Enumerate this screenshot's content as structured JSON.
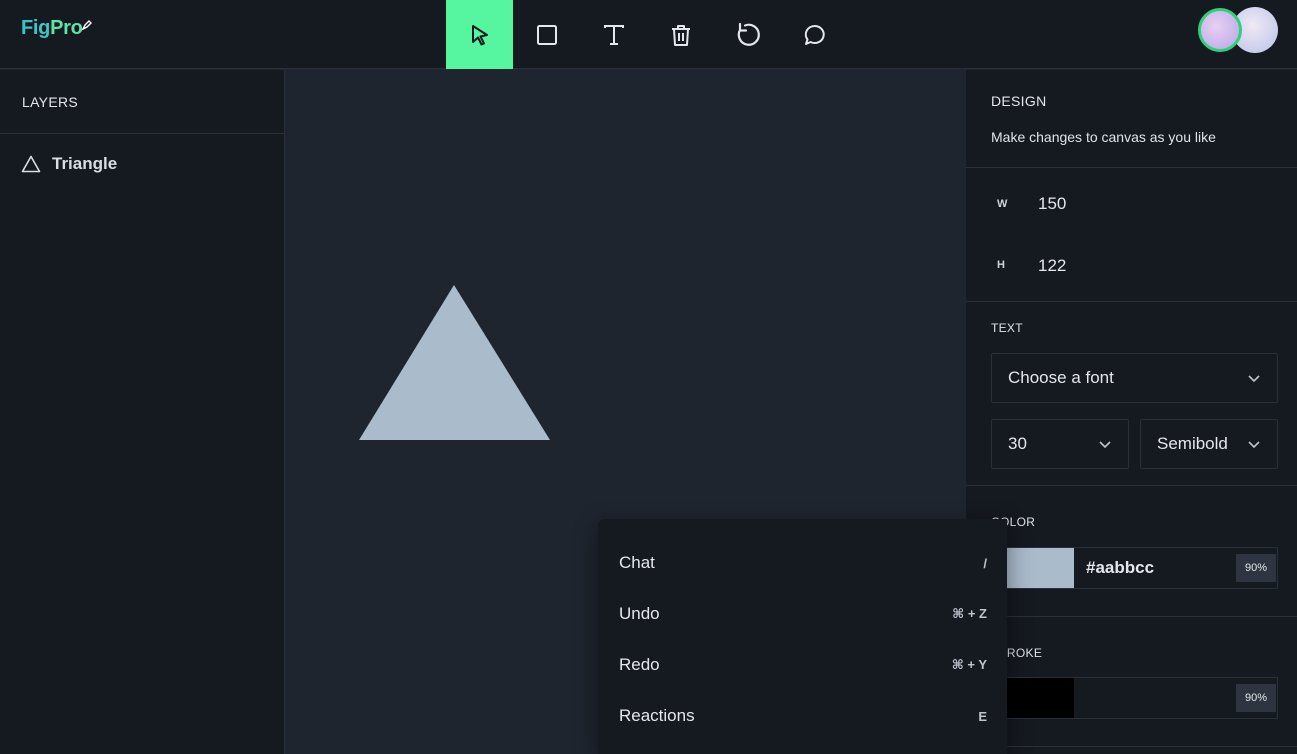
{
  "app": {
    "logo_text": "FigPro"
  },
  "toolbar": {
    "tools": [
      {
        "name": "select",
        "icon": "cursor-icon",
        "active": true
      },
      {
        "name": "rectangle",
        "icon": "square-icon",
        "active": false
      },
      {
        "name": "text",
        "icon": "text-icon",
        "active": false
      },
      {
        "name": "delete",
        "icon": "trash-icon",
        "active": false
      },
      {
        "name": "reset",
        "icon": "refresh-icon",
        "active": false
      },
      {
        "name": "comments",
        "icon": "comment-icon",
        "active": false
      }
    ],
    "accent_color": "#56f5a0"
  },
  "layers": {
    "title": "LAYERS",
    "items": [
      {
        "label": "Triangle",
        "icon": "triangle-icon"
      }
    ]
  },
  "canvas": {
    "shape": "triangle",
    "fill": "#aabbcc"
  },
  "design": {
    "title": "DESIGN",
    "subtitle": "Make changes to canvas as you like",
    "width_key": "W",
    "width_value": "150",
    "height_key": "H",
    "height_value": "122",
    "text_section": {
      "title": "TEXT",
      "font_placeholder": "Choose a font",
      "font_size": "30",
      "font_weight": "Semibold"
    },
    "color_section": {
      "title": "COLOR",
      "swatch": "#aabbcc",
      "hex": "#aabbcc",
      "opacity": "90%"
    },
    "stroke_section": {
      "title": "STROKE",
      "swatch": "#000000",
      "hex": "",
      "opacity": "90%"
    }
  },
  "context_menu": {
    "items": [
      {
        "label": "Chat",
        "shortcut": "/"
      },
      {
        "label": "Undo",
        "shortcut": "⌘ + Z"
      },
      {
        "label": "Redo",
        "shortcut": "⌘ + Y"
      },
      {
        "label": "Reactions",
        "shortcut": "E"
      }
    ]
  }
}
